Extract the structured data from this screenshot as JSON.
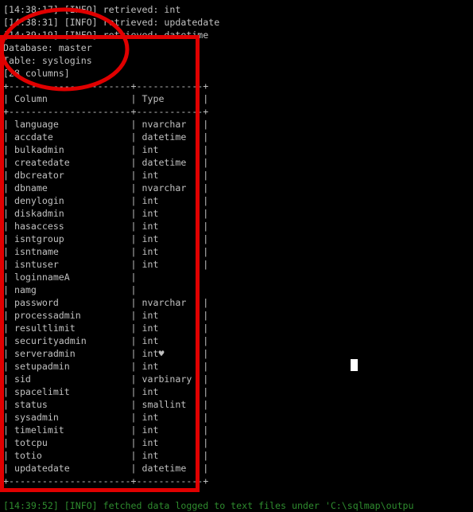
{
  "log_top": [
    "[14:38:17] [INFO] retrieved: int",
    "[14:38:31] [INFO] retrieved: updatedate",
    "[14:39:19] [INFO] retrieved: datetime"
  ],
  "db": {
    "database": "Database: master",
    "table": "Table: syslogins",
    "columns_count": "[28 columns]"
  },
  "table": {
    "border": "+----------------------+------------+",
    "header": "| Column               | Type       |",
    "rows": [
      "| language             | nvarchar   |",
      "| accdate              | datetime   |",
      "| bulkadmin            | int        |",
      "| createdate           | datetime   |",
      "| dbcreator            | int        |",
      "| dbname               | nvarchar   |",
      "| denylogin            | int        |",
      "| diskadmin            | int        |",
      "| hasaccess            | int        |",
      "| isntgroup            | int        |",
      "| isntname             | int        |",
      "| isntuser             | int        |",
      "| loginnameA           |",
      "| namg                 |",
      "| password             | nvarchar   |",
      "| processadmin         | int        |",
      "| resultlimit          | int        |",
      "| securityadmin        | int        |",
      "| serveradmin          | int♥       |",
      "| setupadmin           | int        |",
      "| sid                  | varbinary  |",
      "| spacelimit           | int        |",
      "| status               | smallint   |",
      "| sysadmin             | int        |",
      "| timelimit            | int        |",
      "| totcpu               | int        |",
      "| totio                | int        |",
      "| updatedate           | datetime   |"
    ]
  },
  "log_bottom": "[14:39:52] [INFO] fetched data logged to text files under 'C:\\sqlmap\\outpu",
  "colors": {
    "text": "#c0c0c0",
    "green": "#2e8b2e",
    "annotation": "#e00000",
    "background": "#000000"
  }
}
